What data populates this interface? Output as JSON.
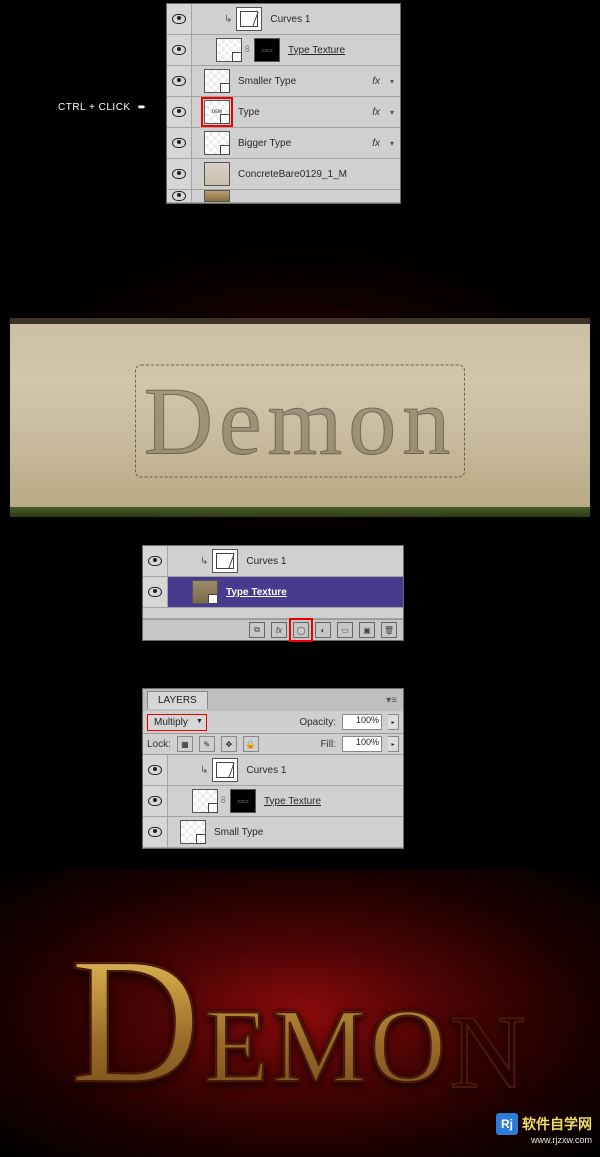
{
  "annotation": {
    "ctrl_click": "CTRL + CLICK",
    "arrow": "➨"
  },
  "panel1": {
    "layers": [
      {
        "name": "Curves 1",
        "fx": false,
        "thumbs": [
          "curve"
        ],
        "indent": 2,
        "clip": true
      },
      {
        "name": "Type Texture",
        "fx": false,
        "thumbs": [
          "checker",
          "link",
          "mask"
        ],
        "indent": 1
      },
      {
        "name": "Smaller Type",
        "fx": true,
        "thumbs": [
          "checker"
        ],
        "indent": 0
      },
      {
        "name": "Type",
        "fx": true,
        "thumbs": [
          "checker-red"
        ],
        "indent": 0,
        "highlight": true
      },
      {
        "name": "Bigger Type",
        "fx": true,
        "thumbs": [
          "checker"
        ],
        "indent": 0
      },
      {
        "name": "ConcreteBare0129_1_M",
        "fx": false,
        "thumbs": [
          "concrete"
        ],
        "indent": 0
      }
    ]
  },
  "concrete": {
    "text": "Demon"
  },
  "panel2": {
    "layers": [
      {
        "name": "Curves 1",
        "thumbs": [
          "curve"
        ],
        "indent": 2
      },
      {
        "name": "Type Texture",
        "thumbs": [
          "tex",
          "mask"
        ],
        "indent": 1,
        "selected": true
      }
    ],
    "bottom_icons": [
      "link",
      "fx",
      "mask",
      "adj",
      "group",
      "new",
      "trash"
    ],
    "highlight_icon_index": 2
  },
  "panel3": {
    "tab_label": "LAYERS",
    "blend_mode": "Multiply",
    "opacity_label": "Opacity:",
    "opacity_value": "100%",
    "lock_label": "Lock:",
    "fill_label": "Fill:",
    "fill_value": "100%",
    "layers": [
      {
        "name": "Curves 1",
        "thumbs": [
          "curve"
        ],
        "indent": 2,
        "clip": true
      },
      {
        "name": "Type Texture",
        "thumbs": [
          "checker",
          "link",
          "mask"
        ],
        "indent": 1
      },
      {
        "name": "Small Type",
        "thumbs": [
          "checker"
        ],
        "indent": 0
      }
    ]
  },
  "demon": {
    "text": "Demon"
  },
  "watermark": {
    "logo": "Rj",
    "text": "软件自学网",
    "url": "www.rjzxw.com"
  }
}
